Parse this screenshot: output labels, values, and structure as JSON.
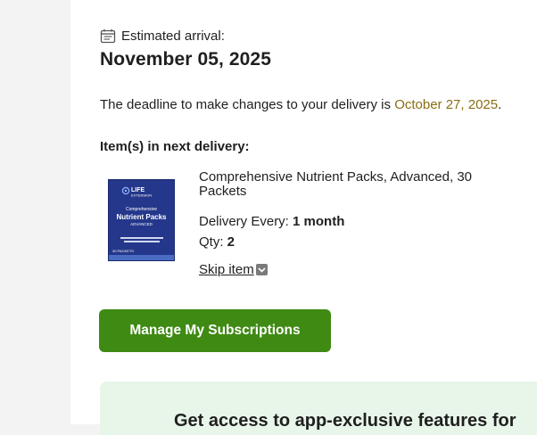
{
  "arrival": {
    "label": "Estimated arrival:",
    "date": "November 05, 2025",
    "icon": "calendar-icon"
  },
  "deadline": {
    "prefix": "The deadline to make changes to your delivery is ",
    "date": "October 27, 2025",
    "suffix": ".",
    "date_color": "#8a6d12"
  },
  "items_heading": "Item(s) in next delivery:",
  "product": {
    "name": "Comprehensive Nutrient Packs, Advanced, 30 Packets",
    "image_lines": {
      "brand": "LIFE",
      "brand_sub": "EXTENSION",
      "line1": "Comprehensive",
      "line2": "Nutrient Packs",
      "line3": "ADVANCED",
      "count": "30 PACKETS"
    },
    "delivery_label": "Delivery Every: ",
    "delivery_value": "1 month",
    "qty_label": "Qty: ",
    "qty_value": "2",
    "skip_label": "Skip item",
    "skip_icon": "chevron-down-icon"
  },
  "manage_button": {
    "label": "Manage My Subscriptions",
    "color": "#3f8a13"
  },
  "promo": {
    "text": "Get access to app-exclusive features for"
  }
}
